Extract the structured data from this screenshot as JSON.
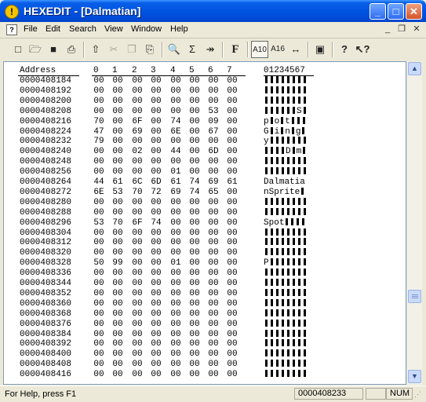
{
  "window": {
    "title": "HEXEDIT - [Dalmatian]",
    "app_icon_glyph": "!"
  },
  "menubar": {
    "items": [
      "File",
      "Edit",
      "Search",
      "View",
      "Window",
      "Help"
    ]
  },
  "toolbar": {
    "buttons": [
      {
        "name": "new-icon",
        "glyph": "□"
      },
      {
        "name": "open-icon",
        "glyph": "🗁"
      },
      {
        "name": "save-icon",
        "glyph": "■"
      },
      {
        "name": "print-icon",
        "glyph": "⎙"
      },
      {
        "name": "export-icon",
        "glyph": "⇧"
      },
      {
        "name": "cut-icon",
        "glyph": "✂"
      },
      {
        "name": "copy-icon",
        "glyph": "❐"
      },
      {
        "name": "paste-icon",
        "glyph": "⎘"
      },
      {
        "name": "find-icon",
        "glyph": "🔍"
      },
      {
        "name": "calculator-icon",
        "glyph": "Σ"
      },
      {
        "name": "goto-icon",
        "glyph": "↠"
      },
      {
        "name": "font-icon",
        "glyph": "F"
      },
      {
        "name": "ascii-mode-icon",
        "glyph": "A10"
      },
      {
        "name": "hex-mode-icon",
        "glyph": "A16"
      },
      {
        "name": "autofit-icon",
        "glyph": "↔"
      },
      {
        "name": "properties-icon",
        "glyph": "▣"
      },
      {
        "name": "help-icon",
        "glyph": "?"
      },
      {
        "name": "context-help-icon",
        "glyph": "↖?"
      }
    ]
  },
  "editor": {
    "address_header": "Address",
    "hex_column_headers": [
      "0",
      "1",
      "2",
      "3",
      "4",
      "5",
      "6",
      "7"
    ],
    "ascii_header": "01234567",
    "rows": [
      {
        "addr": "0000408184",
        "hex": [
          "00",
          "00",
          "00",
          "00",
          "00",
          "00",
          "00",
          "00"
        ],
        "ascii": "########"
      },
      {
        "addr": "0000408192",
        "hex": [
          "00",
          "00",
          "00",
          "00",
          "00",
          "00",
          "00",
          "00"
        ],
        "ascii": "########"
      },
      {
        "addr": "0000408200",
        "hex": [
          "00",
          "00",
          "00",
          "00",
          "00",
          "00",
          "00",
          "00"
        ],
        "ascii": "########"
      },
      {
        "addr": "0000408208",
        "hex": [
          "00",
          "00",
          "00",
          "00",
          "00",
          "00",
          "53",
          "00"
        ],
        "ascii": "######S#"
      },
      {
        "addr": "0000408216",
        "hex": [
          "70",
          "00",
          "6F",
          "00",
          "74",
          "00",
          "09",
          "00"
        ],
        "ascii": "p#o#t###"
      },
      {
        "addr": "0000408224",
        "hex": [
          "47",
          "00",
          "69",
          "00",
          "6E",
          "00",
          "67",
          "00"
        ],
        "ascii": "G#i#n#g#"
      },
      {
        "addr": "0000408232",
        "hex": [
          "79",
          "00",
          "00",
          "00",
          "00",
          "00",
          "00",
          "00"
        ],
        "ascii": "y#######"
      },
      {
        "addr": "0000408240",
        "hex": [
          "00",
          "00",
          "02",
          "00",
          "44",
          "00",
          "6D",
          "00"
        ],
        "ascii": "####D#m#"
      },
      {
        "addr": "0000408248",
        "hex": [
          "00",
          "00",
          "00",
          "00",
          "00",
          "00",
          "00",
          "00"
        ],
        "ascii": "########"
      },
      {
        "addr": "0000408256",
        "hex": [
          "00",
          "00",
          "00",
          "00",
          "01",
          "00",
          "00",
          "00"
        ],
        "ascii": "########"
      },
      {
        "addr": "0000408264",
        "hex": [
          "44",
          "61",
          "6C",
          "6D",
          "61",
          "74",
          "69",
          "61"
        ],
        "ascii": "Dalmatia"
      },
      {
        "addr": "0000408272",
        "hex": [
          "6E",
          "53",
          "70",
          "72",
          "69",
          "74",
          "65",
          "00"
        ],
        "ascii": "nSprite#"
      },
      {
        "addr": "0000408280",
        "hex": [
          "00",
          "00",
          "00",
          "00",
          "00",
          "00",
          "00",
          "00"
        ],
        "ascii": "########"
      },
      {
        "addr": "0000408288",
        "hex": [
          "00",
          "00",
          "00",
          "00",
          "00",
          "00",
          "00",
          "00"
        ],
        "ascii": "########"
      },
      {
        "addr": "0000408296",
        "hex": [
          "53",
          "70",
          "6F",
          "74",
          "00",
          "00",
          "00",
          "00"
        ],
        "ascii": "Spot####"
      },
      {
        "addr": "0000408304",
        "hex": [
          "00",
          "00",
          "00",
          "00",
          "00",
          "00",
          "00",
          "00"
        ],
        "ascii": "########"
      },
      {
        "addr": "0000408312",
        "hex": [
          "00",
          "00",
          "00",
          "00",
          "00",
          "00",
          "00",
          "00"
        ],
        "ascii": "########"
      },
      {
        "addr": "0000408320",
        "hex": [
          "00",
          "00",
          "00",
          "00",
          "00",
          "00",
          "00",
          "00"
        ],
        "ascii": "########"
      },
      {
        "addr": "0000408328",
        "hex": [
          "50",
          "99",
          "00",
          "00",
          "01",
          "00",
          "00",
          "00"
        ],
        "ascii": "P#######"
      },
      {
        "addr": "0000408336",
        "hex": [
          "00",
          "00",
          "00",
          "00",
          "00",
          "00",
          "00",
          "00"
        ],
        "ascii": "########"
      },
      {
        "addr": "0000408344",
        "hex": [
          "00",
          "00",
          "00",
          "00",
          "00",
          "00",
          "00",
          "00"
        ],
        "ascii": "########"
      },
      {
        "addr": "0000408352",
        "hex": [
          "00",
          "00",
          "00",
          "00",
          "00",
          "00",
          "00",
          "00"
        ],
        "ascii": "########"
      },
      {
        "addr": "0000408360",
        "hex": [
          "00",
          "00",
          "00",
          "00",
          "00",
          "00",
          "00",
          "00"
        ],
        "ascii": "########"
      },
      {
        "addr": "0000408368",
        "hex": [
          "00",
          "00",
          "00",
          "00",
          "00",
          "00",
          "00",
          "00"
        ],
        "ascii": "########"
      },
      {
        "addr": "0000408376",
        "hex": [
          "00",
          "00",
          "00",
          "00",
          "00",
          "00",
          "00",
          "00"
        ],
        "ascii": "########"
      },
      {
        "addr": "0000408384",
        "hex": [
          "00",
          "00",
          "00",
          "00",
          "00",
          "00",
          "00",
          "00"
        ],
        "ascii": "########"
      },
      {
        "addr": "0000408392",
        "hex": [
          "00",
          "00",
          "00",
          "00",
          "00",
          "00",
          "00",
          "00"
        ],
        "ascii": "########"
      },
      {
        "addr": "0000408400",
        "hex": [
          "00",
          "00",
          "00",
          "00",
          "00",
          "00",
          "00",
          "00"
        ],
        "ascii": "########"
      },
      {
        "addr": "0000408408",
        "hex": [
          "00",
          "00",
          "00",
          "00",
          "00",
          "00",
          "00",
          "00"
        ],
        "ascii": "########"
      },
      {
        "addr": "0000408416",
        "hex": [
          "00",
          "00",
          "00",
          "00",
          "00",
          "00",
          "00",
          "00"
        ],
        "ascii": "########"
      }
    ]
  },
  "statusbar": {
    "help_text": "For Help, press F1",
    "cursor_address": "0000408233",
    "num_indicator": "NUM"
  },
  "scrollbar": {
    "position_fraction": 0.76
  }
}
